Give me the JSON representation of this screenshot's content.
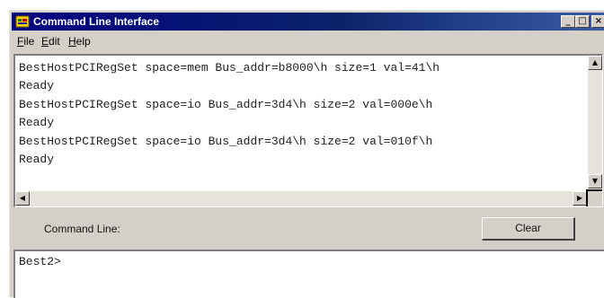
{
  "window": {
    "title": "Command Line Interface",
    "controls": {
      "minimize": "_",
      "maximize": "□",
      "close": "×"
    }
  },
  "menu": [
    {
      "label": "File",
      "underline": "F",
      "rest": "ile"
    },
    {
      "label": "Edit",
      "underline": "E",
      "rest": "dit"
    },
    {
      "label": "Help",
      "underline": "H",
      "rest": "elp"
    }
  ],
  "output": {
    "lines": [
      "BestHostPCIRegSet space=mem Bus_addr=b8000\\h size=1 val=41\\h",
      "Ready",
      "BestHostPCIRegSet space=io Bus_addr=3d4\\h size=2 val=000e\\h",
      "Ready",
      "BestHostPCIRegSet space=io Bus_addr=3d4\\h size=2 val=010f\\h",
      "Ready"
    ]
  },
  "scrollbars": {
    "up_arrow": "▲",
    "down_arrow": "▼",
    "left_arrow": "◀",
    "right_arrow": "▶"
  },
  "command": {
    "label": "Command Line:",
    "clear_label": "Clear",
    "prompt": "Best2>"
  },
  "colors": {
    "titlebar_start": "#000080",
    "titlebar_end": "#3a5aa6",
    "face": "#d4d0c8"
  }
}
